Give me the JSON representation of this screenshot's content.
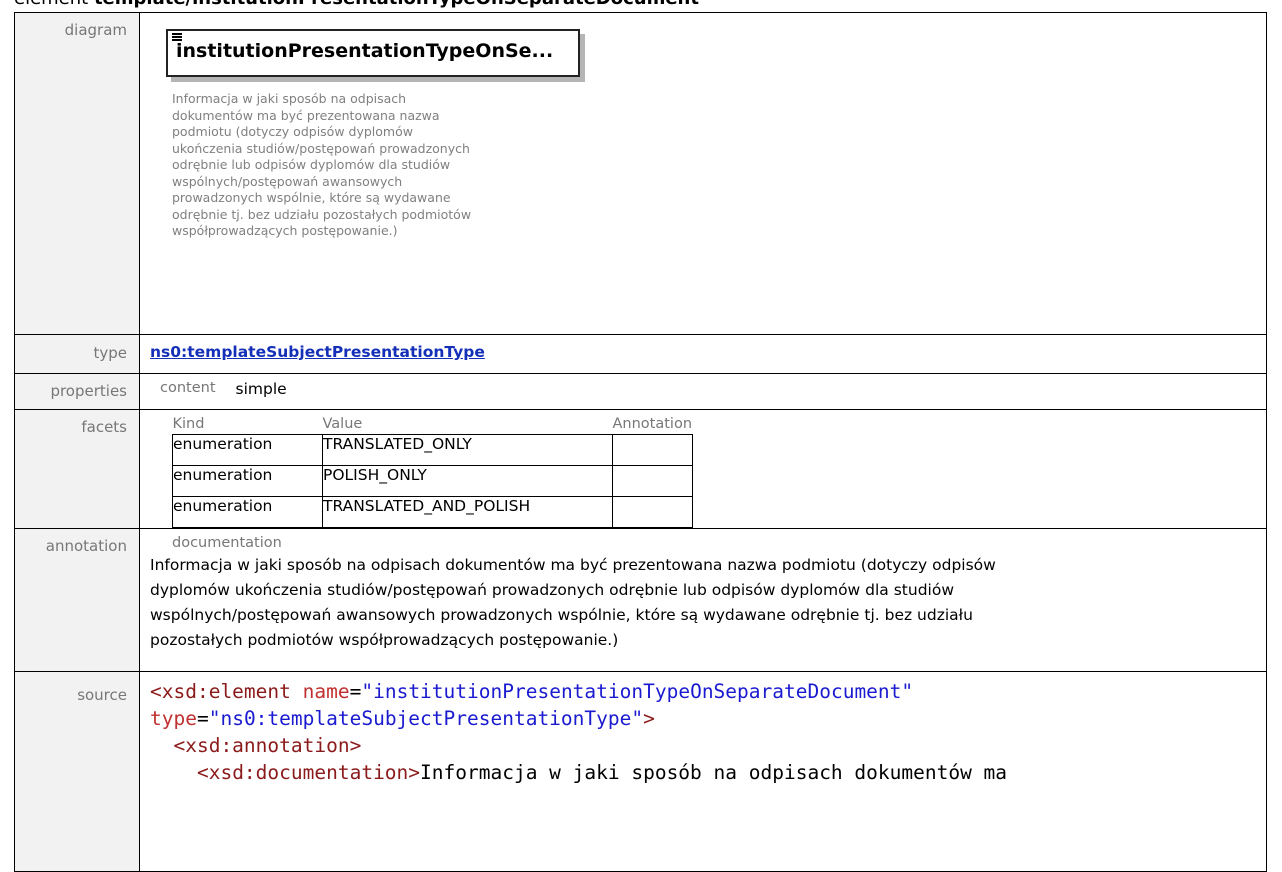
{
  "heading": {
    "prefix": "element ",
    "name": "template/institutionPresentationTypeOnSeparateDocument"
  },
  "rows": {
    "diagram": {
      "label": "diagram",
      "box_title": "institutionPresentationTypeOnSe...",
      "description_lines": [
        "Informacja w jaki sposób na odpisach",
        "dokumentów ma być prezentowana nazwa",
        "podmiotu (dotyczy odpisów dyplomów",
        "ukończenia studiów/postępowań prowadzonych",
        "odrębnie lub odpisów dyplomów dla studiów",
        "wspólnych/postępowań awansowych",
        "prowadzonych wspólnie, które są wydawane",
        "odrębnie tj. bez udziału pozostałych podmiotów",
        "współprowadzących postępowanie.)"
      ]
    },
    "type": {
      "label": "type",
      "value": "ns0:templateSubjectPresentationType"
    },
    "properties": {
      "label": "properties",
      "key": "content",
      "value": "simple"
    },
    "facets": {
      "label": "facets",
      "headers": [
        "Kind",
        "Value",
        "Annotation"
      ],
      "items": [
        {
          "kind": "enumeration",
          "value": "TRANSLATED_ONLY",
          "annotation": ""
        },
        {
          "kind": "enumeration",
          "value": "POLISH_ONLY",
          "annotation": ""
        },
        {
          "kind": "enumeration",
          "value": "TRANSLATED_AND_POLISH",
          "annotation": ""
        }
      ]
    },
    "annotation": {
      "label": "annotation",
      "sub": "documentation",
      "lines": [
        "Informacja w jaki sposób na odpisach dokumentów ma być prezentowana nazwa podmiotu (dotyczy odpisów",
        "dyplomów ukończenia studiów/postępowań prowadzonych odrębnie lub odpisów dyplomów dla studiów",
        "wspólnych/postępowań awansowych prowadzonych wspólnie, które są wydawane odrębnie tj. bez udziału",
        "pozostałych podmiotów współprowadzących postępowanie.)"
      ]
    },
    "source": {
      "label": "source",
      "tag_open": "<xsd:element",
      "attr_name": "name",
      "name_value": "\"institutionPresentationTypeOnSeparateDocument\"",
      "attr_type": "type",
      "type_value": "\"ns0:templateSubjectPresentationType\"",
      "close_bracket": ">",
      "annotation_tag": "<xsd:annotation>",
      "documentation_tag": "<xsd:documentation>",
      "documentation_text": "Informacja w jaki sposób na odpisach dokumentów ma"
    }
  }
}
